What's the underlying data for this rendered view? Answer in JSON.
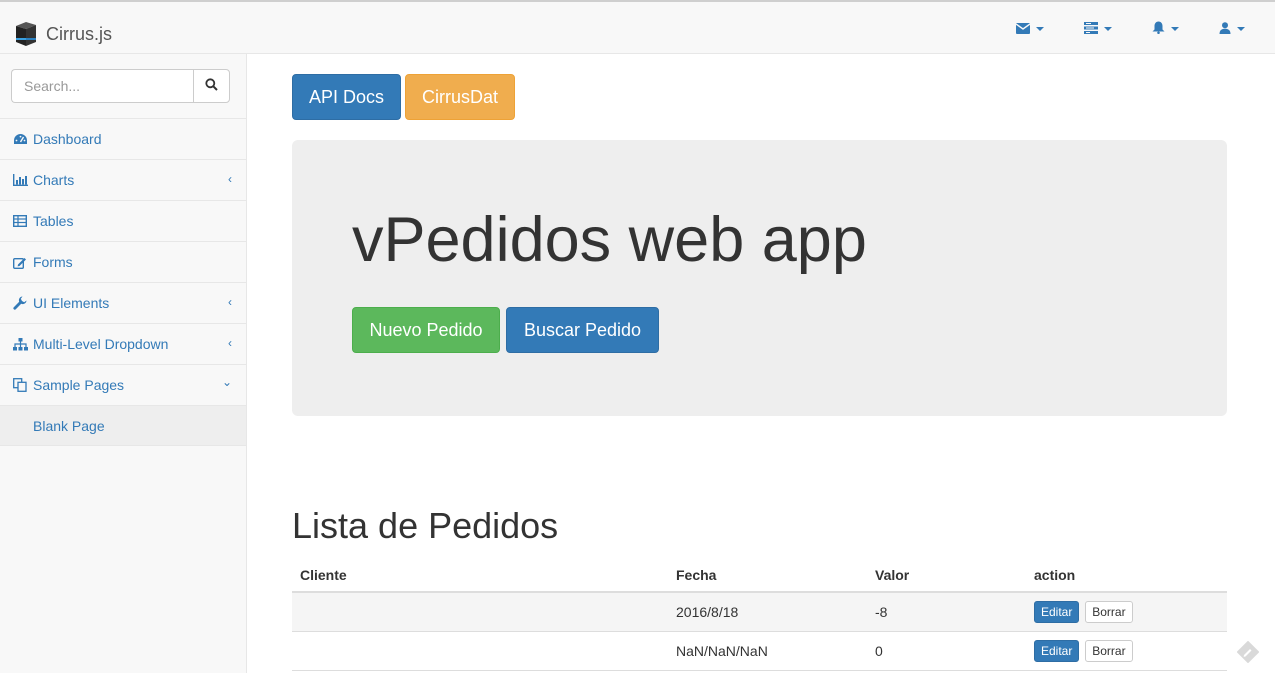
{
  "navbar": {
    "brand": "Cirrus.js",
    "icons": [
      "envelope-icon",
      "tasks-icon",
      "bell-icon",
      "user-icon"
    ]
  },
  "sidebar": {
    "search": {
      "placeholder": "Search..."
    },
    "items": [
      {
        "label": "Dashboard",
        "icon": "dashboard-icon"
      },
      {
        "label": "Charts",
        "icon": "bar-chart-icon"
      },
      {
        "label": "Tables",
        "icon": "table-icon"
      },
      {
        "label": "Forms",
        "icon": "edit-icon"
      },
      {
        "label": "UI Elements",
        "icon": "wrench-icon"
      },
      {
        "label": "Multi-Level Dropdown",
        "icon": "sitemap-icon"
      },
      {
        "label": "Sample Pages",
        "icon": "files-icon"
      }
    ],
    "sub_items": [
      {
        "label": "Blank Page"
      }
    ]
  },
  "main": {
    "top_buttons": {
      "api_docs": "API Docs",
      "cirrusdat": "CirrusDat"
    },
    "jumbotron": {
      "title": "vPedidos web app",
      "new_order": "Nuevo Pedido",
      "search_order": "Buscar Pedido"
    },
    "list_title": "Lista de Pedidos",
    "table": {
      "headers": [
        "Cliente",
        "Fecha",
        "Valor",
        "action"
      ],
      "rows": [
        {
          "cliente": "",
          "fecha": "2016/8/18",
          "valor": "-8",
          "edit": "Editar",
          "delete": "Borrar"
        },
        {
          "cliente": "",
          "fecha": "NaN/NaN/NaN",
          "valor": "0",
          "edit": "Editar",
          "delete": "Borrar"
        }
      ]
    }
  },
  "colors": {
    "primary": "#337ab7",
    "warning": "#f0ad4e",
    "success": "#5cb85c",
    "jumbotron_bg": "#eeeeee",
    "sidebar_bg": "#f8f8f8"
  }
}
